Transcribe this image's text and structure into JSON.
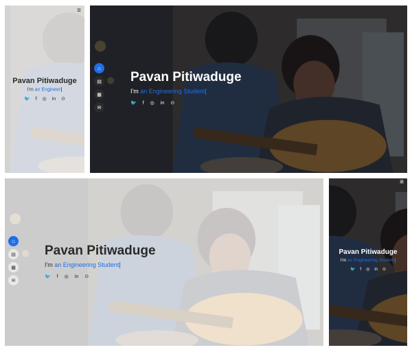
{
  "hero": {
    "name": "Pavan Pitiwaduge",
    "prefix": "I'm",
    "typed_full": "an Engineering Student",
    "typed_partial": "an Engineer"
  },
  "social": [
    "twitter-icon",
    "facebook-icon",
    "instagram-icon",
    "linkedin-icon",
    "github-icon"
  ],
  "nav": [
    "home-icon",
    "about-icon",
    "resume-icon",
    "contact-icon"
  ],
  "colors": {
    "accent": "#1e6ee8",
    "nav_dot_dark": "#2b2b2b",
    "nav_dot_light": "#e9e9e9"
  },
  "glyphs": {
    "twitter": "🐦",
    "facebook": "f",
    "instagram": "◎",
    "linkedin": "in",
    "github": "⊙",
    "home": "⌂",
    "about": "▤",
    "resume": "▦",
    "contact": "✉",
    "menu": "≡"
  }
}
